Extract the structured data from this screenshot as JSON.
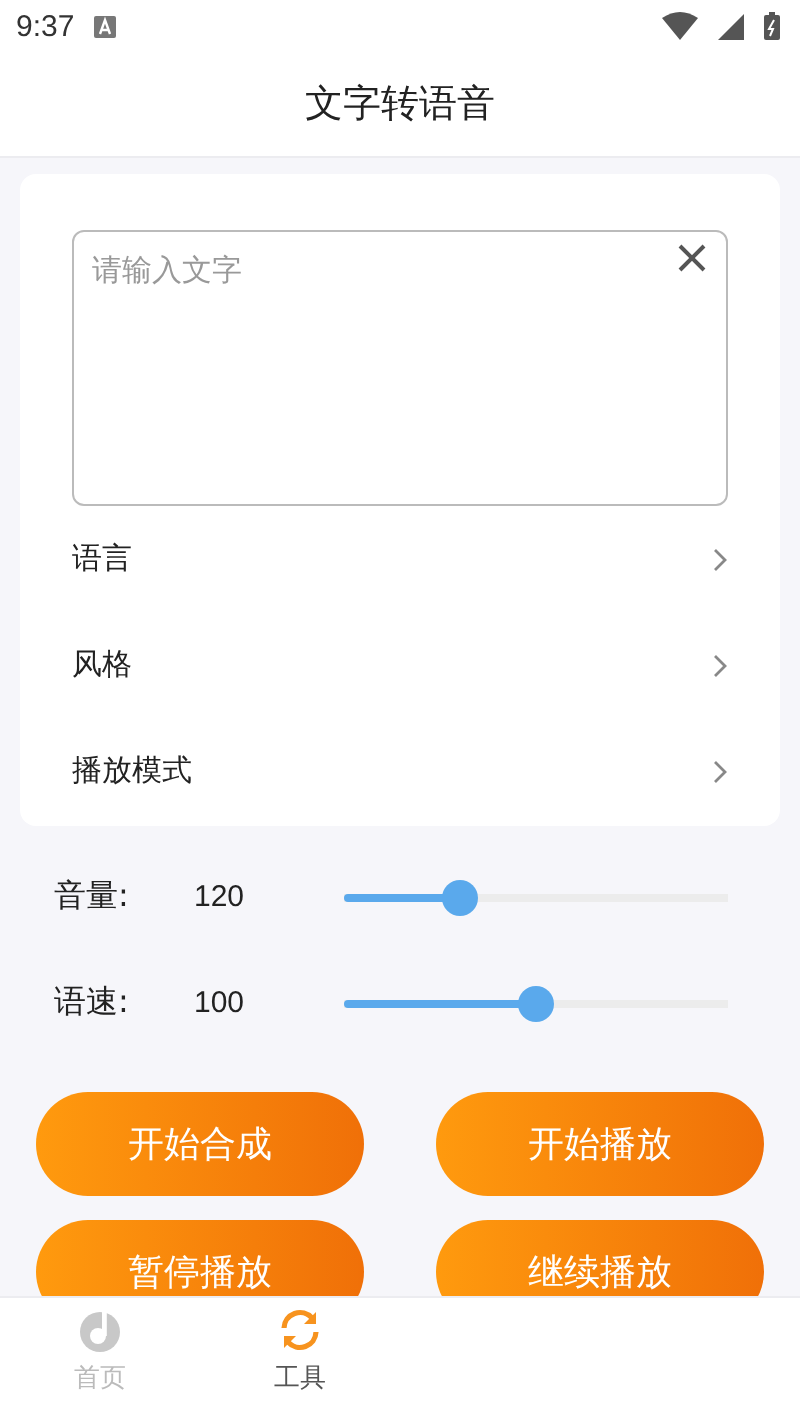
{
  "status_bar": {
    "time": "9:37"
  },
  "header": {
    "title": "文字转语音"
  },
  "text_input": {
    "placeholder": "请输入文字"
  },
  "options": [
    {
      "label": "语言"
    },
    {
      "label": "风格"
    },
    {
      "label": "播放模式"
    }
  ],
  "sliders": [
    {
      "label": "音量:",
      "reading": "120",
      "level": 0.3
    },
    {
      "label": "语速:",
      "reading": "100",
      "level": 0.5
    }
  ],
  "buttons": [
    "开始合成",
    "开始播放",
    "暂停播放",
    "继续播放"
  ],
  "bottom_nav": [
    {
      "label": "首页",
      "selected": false,
      "kind": "home"
    },
    {
      "label": "工具",
      "selected": true,
      "kind": "tools"
    }
  ]
}
